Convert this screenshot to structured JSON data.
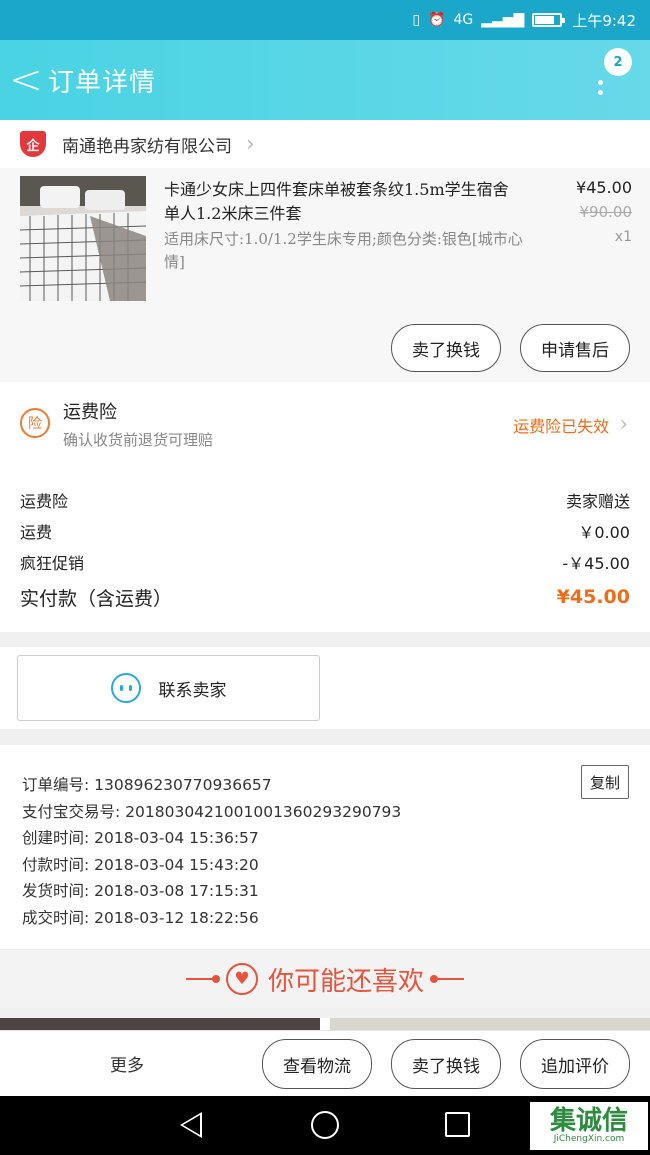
{
  "status_bar": {
    "signal": "4G",
    "time": "上午9:42"
  },
  "header": {
    "back": "<",
    "title": "订单详情",
    "badge_count": "2"
  },
  "shop": {
    "icon_text": "企",
    "name": "南通艳冉家纺有限公司"
  },
  "product": {
    "title": "卡通少女床上四件套床单被套条纹1.5m学生宿舍单人1.2米床三件套",
    "sku": "适用床尺寸:1.0/1.2学生床专用;颜色分类:银色[城市心情]",
    "price_now": "¥45.00",
    "price_old": "¥90.00",
    "qty": "x1",
    "btn_exchange": "卖了换钱",
    "btn_aftersale": "申请售后"
  },
  "insurance": {
    "icon_text": "险",
    "title": "运费险",
    "subtitle": "确认收货前退货可理赔",
    "status": "运费险已失效"
  },
  "fees": [
    {
      "label": "运费险",
      "value": "卖家赠送"
    },
    {
      "label": "运费",
      "value": "￥0.00"
    },
    {
      "label": "疯狂促销",
      "value": "-￥45.00"
    }
  ],
  "total": {
    "label": "实付款（含运费）",
    "value": "¥45.00"
  },
  "contact": {
    "label": "联系卖家"
  },
  "order_info": {
    "copy_label": "复制",
    "rows": [
      "订单编号: 130896230770936657",
      "支付宝交易号: 2018030421001001360293290793",
      "创建时间: 2018-03-04 15:36:57",
      "付款时间: 2018-03-04 15:43:20",
      "发货时间: 2018-03-08 17:15:31",
      "成交时间: 2018-03-12 18:22:56"
    ]
  },
  "recommend": {
    "title": "你可能还喜欢"
  },
  "bottom_bar": {
    "more": "更多",
    "logistics": "查看物流",
    "exchange": "卖了换钱",
    "review": "追加评价"
  },
  "watermark": {
    "main": "集诚信",
    "sub": "JiChengXin.com"
  }
}
